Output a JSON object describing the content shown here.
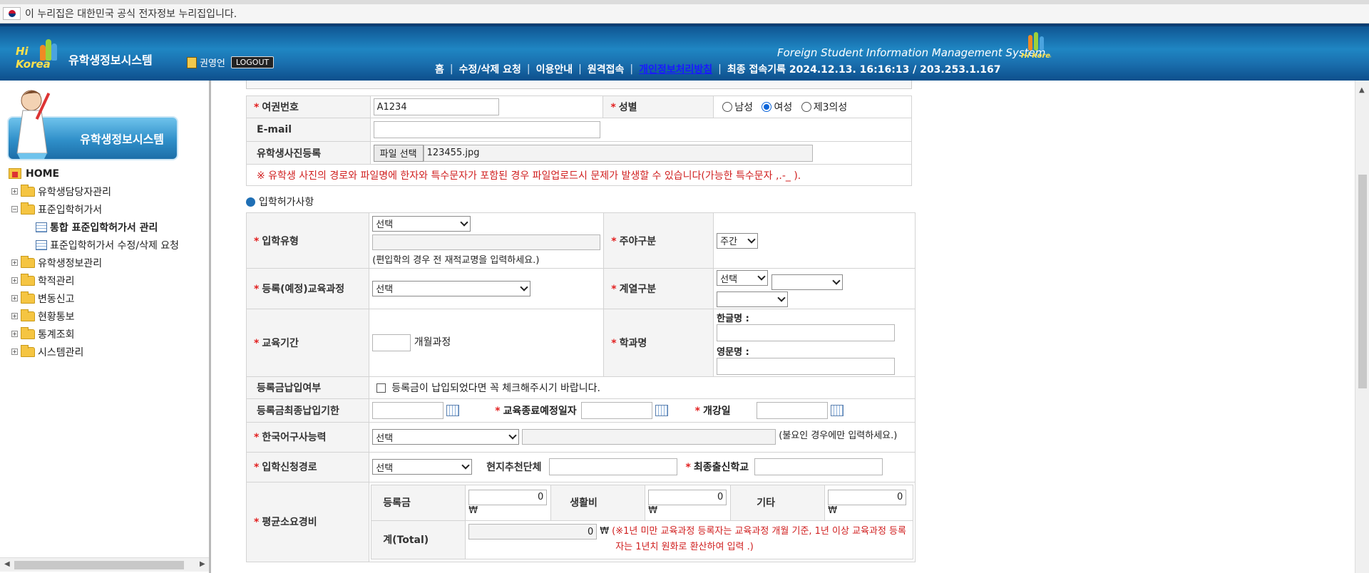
{
  "gov_banner": {
    "text": "이 누리집은 대한민국 공식 전자정보 누리집입니다."
  },
  "header": {
    "logo_text": "Hi Korea",
    "system_name": "유학생정보시스템",
    "user_name": "권영언",
    "logout_label": "LOGOUT",
    "english_title": "Foreign Student Information Management System",
    "nav": [
      "홈",
      "수정/삭제 요청",
      "이용안내",
      "원격접속",
      "개인정보처리방침"
    ],
    "last_login": "최종 접속기록 2024.12.13. 16:16:13 / 203.253.1.167"
  },
  "sidebar": {
    "banner_title": "유학생정보시스템",
    "home": "HOME",
    "items": [
      {
        "label": "유학생담당자관리",
        "type": "folder"
      },
      {
        "label": "표준입학허가서",
        "type": "folder-open"
      },
      {
        "label": "통합 표준입학허가서 관리",
        "type": "doc",
        "active": true
      },
      {
        "label": "표준입학허가서 수정/삭제 요청",
        "type": "doc"
      },
      {
        "label": "유학생정보관리",
        "type": "folder"
      },
      {
        "label": "학적관리",
        "type": "folder"
      },
      {
        "label": "변동신고",
        "type": "folder"
      },
      {
        "label": "현황통보",
        "type": "folder"
      },
      {
        "label": "통계조회",
        "type": "folder"
      },
      {
        "label": "시스템관리",
        "type": "folder"
      }
    ]
  },
  "form1": {
    "passport_label": "여권번호",
    "passport_value": "A1234",
    "gender_label": "성별",
    "gender_options": [
      "남성",
      "여성",
      "제3의성"
    ],
    "gender_selected": "여성",
    "email_label": "E-mail",
    "email_value": "",
    "photo_label": "유학생사진등록",
    "file_button": "파일 선택",
    "file_name": "123455.jpg",
    "photo_warning": "※ 유학생 사진의 경로와 파일명에 한자와 특수문자가 포함된 경우 파일업로드시 문제가 발생할 수 있습니다(가능한 특수문자 ,.-_ )."
  },
  "section": {
    "title": "입학허가사항"
  },
  "form2": {
    "admission_type_label": "입학유형",
    "admission_type_value": "선택",
    "admission_type_hint": "(편입학의 경우 전 재적교명을 입력하세요.)",
    "daynight_label": "주야구분",
    "daynight_value": "주간",
    "course_label": "등록(예정)교육과정",
    "course_value": "선택",
    "field_label": "계열구분",
    "field_value1": "선택",
    "field_value2": "",
    "field_value3": "",
    "period_label": "교육기간",
    "period_unit": "개월과정",
    "dept_label": "학과명",
    "dept_ko_label": "한글명 :",
    "dept_en_label": "영문명 :",
    "tuition_paid_label": "등록금납입여부",
    "tuition_paid_text": "등록금이 납입되었다면 꼭 체크해주시기 바랍니다.",
    "tuition_deadline_label": "등록금최종납입기한",
    "edu_end_label": "교육종료예정일자",
    "open_date_label": "개강일",
    "korean_label": "한국어구사능력",
    "korean_value": "선택",
    "korean_hint": "(불요인 경우에만 입력하세요.)",
    "route_label": "입학신청경로",
    "route_value": "선택",
    "local_org_label": "현지추천단체",
    "last_school_label": "최종출신학교",
    "cost_label": "평균소요경비",
    "tuition_label": "등록금",
    "tuition_value": "0",
    "living_label": "생활비",
    "living_value": "0",
    "other_label": "기타",
    "other_value": "0",
    "currency": "₩",
    "total_label": "계(Total)",
    "total_value": "0",
    "total_note_prefix": "(",
    "total_note": "※1년 미만 교육과정 등록자는 교육과정 개월 기준, 1년 이상 교육과정 등록자는 1년치 원화로 환산하여 입력 .)"
  },
  "colors": {
    "header_blue": "#1a6fae",
    "required_red": "#e21f1f",
    "warning_red": "#d01f1f",
    "label_bg": "#f4f4f4"
  }
}
